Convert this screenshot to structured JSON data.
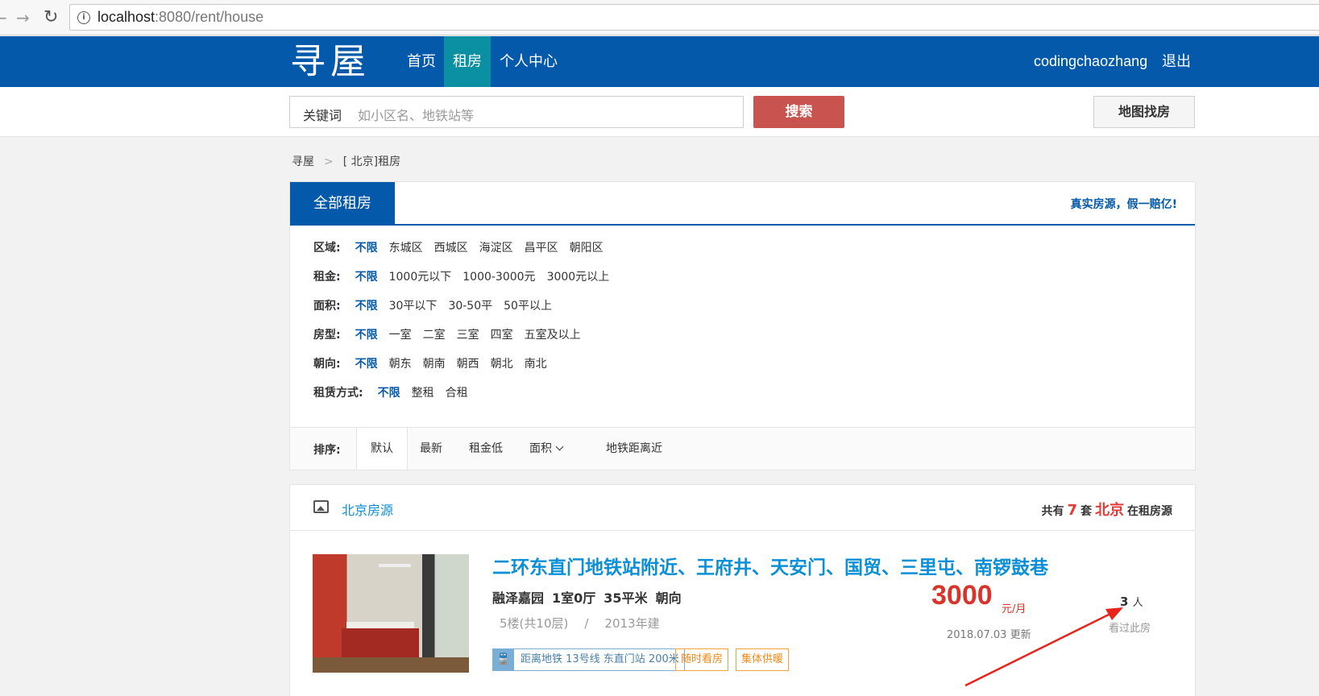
{
  "browser": {
    "back": "←",
    "forward": "→",
    "reload": "↻",
    "url_host": "localhost",
    "url_rest": ":8080/rent/house"
  },
  "header": {
    "logo": "寻屋",
    "nav": [
      "首页",
      "租房",
      "个人中心"
    ],
    "active_nav": "租房",
    "username": "codingchaozhang",
    "logout": "退出"
  },
  "search": {
    "label": "关键词",
    "placeholder": "如小区名、地铁站等",
    "button": "搜索",
    "map_button": "地图找房"
  },
  "breadcrumb": [
    "寻屋",
    "[ 北京]租房"
  ],
  "filter": {
    "tab": "全部租房",
    "slogan": "真实房源，假一赔亿!",
    "rows": [
      {
        "label": "区域:",
        "options": [
          "不限",
          "东城区",
          "西城区",
          "海淀区",
          "昌平区",
          "朝阳区"
        ]
      },
      {
        "label": "租金:",
        "options": [
          "不限",
          "1000元以下",
          "1000-3000元",
          "3000元以上"
        ]
      },
      {
        "label": "面积:",
        "options": [
          "不限",
          "30平以下",
          "30-50平",
          "50平以上"
        ]
      },
      {
        "label": "房型:",
        "options": [
          "不限",
          "一室",
          "二室",
          "三室",
          "四室",
          "五室及以上"
        ]
      },
      {
        "label": "朝向:",
        "options": [
          "不限",
          "朝东",
          "朝南",
          "朝西",
          "朝北",
          "南北"
        ]
      },
      {
        "label": "租赁方式:",
        "options": [
          "不限",
          "整租",
          "合租"
        ]
      }
    ],
    "sort_label": "排序:",
    "sort_options": [
      "默认",
      "最新",
      "租金低",
      "面积",
      "地铁距离近"
    ]
  },
  "listing": {
    "section_title": "北京房源",
    "count_prefix": "共有",
    "count": "7",
    "count_mid": "套",
    "city": "北京",
    "count_suffix": "在租房源",
    "house": {
      "title": "二环东直门地铁站附近、王府井、天安门、国贸、三里屯、南锣鼓巷",
      "community": "融泽嘉园",
      "layout": "1室0厅",
      "area": "35平米",
      "direction": "朝向",
      "floor": "5楼(共10层)",
      "slash": "/",
      "built": "2013年建",
      "subway_icon": "🚆",
      "subway": "距离地铁 13号线 东直门站 200米",
      "tags": [
        "随时看房",
        "集体供暖"
      ],
      "price": "3000",
      "price_unit": "元/月",
      "updated": "2018.07.03 更新",
      "viewers": "3",
      "viewers_unit": "人",
      "viewers_label": "看过此房"
    }
  },
  "colors": {
    "brand_blue": "#0459aa",
    "active_teal": "#0b8fa2",
    "search_red": "#c9534f",
    "link_blue": "#0b8fd6",
    "price_red": "#d9342b"
  }
}
